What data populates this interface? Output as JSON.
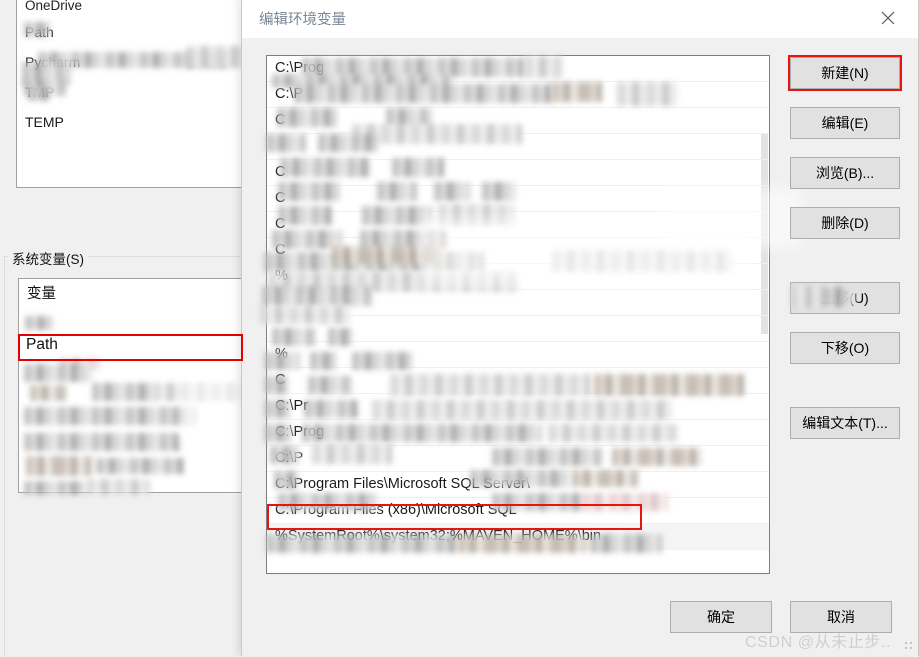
{
  "background_window": {
    "user_variables_list": {
      "rows": [
        {
          "text": "OneDrive",
          "redacted": false
        },
        {
          "text": "Path",
          "redacted": true
        },
        {
          "text": "Pycharm",
          "redacted": true
        },
        {
          "text": "TMP",
          "redacted": true
        },
        {
          "text": "TEMP",
          "redacted": true
        }
      ]
    },
    "system_variables": {
      "group_label": "系统变量(S)",
      "column_header": "变量",
      "rows": [
        {
          "text": "",
          "redacted": true
        },
        {
          "text": "Path",
          "redacted": false,
          "selected": true
        },
        {
          "text": "",
          "redacted": true
        },
        {
          "text": "DOCKER_A",
          "redacted": true
        },
        {
          "text": "",
          "redacted": true
        },
        {
          "text": "",
          "redacted": true
        },
        {
          "text": "",
          "redacted": true
        },
        {
          "text": "PSM",
          "redacted": true
        }
      ],
      "selected_row": "Path"
    }
  },
  "dialog": {
    "title": "编辑环境变量",
    "close_icon": "close-icon",
    "path_entries": [
      {
        "text": "C:\\Prog",
        "tail": "th",
        "redacted": true
      },
      {
        "text": "C:\\P",
        "tail": "Javapa",
        "redacted": true
      },
      {
        "text": "C",
        "tail": "s\\system",
        "redacted": true
      },
      {
        "text": "",
        "tail": "M",
        "redacted": true
      },
      {
        "text": "C",
        "tail": "syste",
        "redacted": true
      },
      {
        "text": "C",
        "tail": "ster",
        "redacted": true
      },
      {
        "text": "C",
        "tail": "s\\System32\\WindowsPowerShell\\v1.0\\",
        "redacted": true
      },
      {
        "text": "C",
        "tail": "s\\Syst",
        "redacted": true
      },
      {
        "text": "%",
        "tail": "",
        "redacted": true
      },
      {
        "text": "",
        "tail": "crosoft",
        "redacted": true
      },
      {
        "text": "",
        "tail": "",
        "redacted": true
      },
      {
        "text": "%",
        "tail": "\\b",
        "redacted": true
      },
      {
        "text": "C",
        "tail": "s\\my",
        "redacted": true
      },
      {
        "text": "C:\\Pr",
        "tail": "ogram Files\\",
        "redacted": true
      },
      {
        "text": "C:\\Prog",
        "tail": "ram Files (x",
        "redacted": true
      },
      {
        "text": "C:\\P",
        "tail": "",
        "redacted": true
      },
      {
        "text": "C:\\Program Files\\Microsoft SQL Server\\",
        "tail": "bin\\",
        "redacted": true
      },
      {
        "text": "C:\\Program Files (x86)\\Microsoft SQL",
        "tail": "",
        "redacted": true
      },
      {
        "text": "%SystemRoot%\\system32;%MAVEN_HOME%\\bin",
        "tail": "",
        "redacted": false,
        "selected": true
      },
      {
        "text": "",
        "tail": "\\bin",
        "redacted": true
      }
    ],
    "selected_entry": "%SystemRoot%\\system32;%MAVEN_HOME%\\bin",
    "buttons": {
      "new": "新建(N)",
      "edit": "编辑(E)",
      "browse": "浏览(B)...",
      "delete": "删除(D)",
      "move_up": "上移(U)",
      "move_down": "下移(O)",
      "edit_text": "编辑文本(T)..."
    },
    "footer": {
      "ok": "确定",
      "cancel": "取消"
    }
  },
  "annotations": {
    "highlight_color": "#e8150f",
    "accent_blue": "#0078d7"
  },
  "watermark": "CSDN @从未止步.."
}
